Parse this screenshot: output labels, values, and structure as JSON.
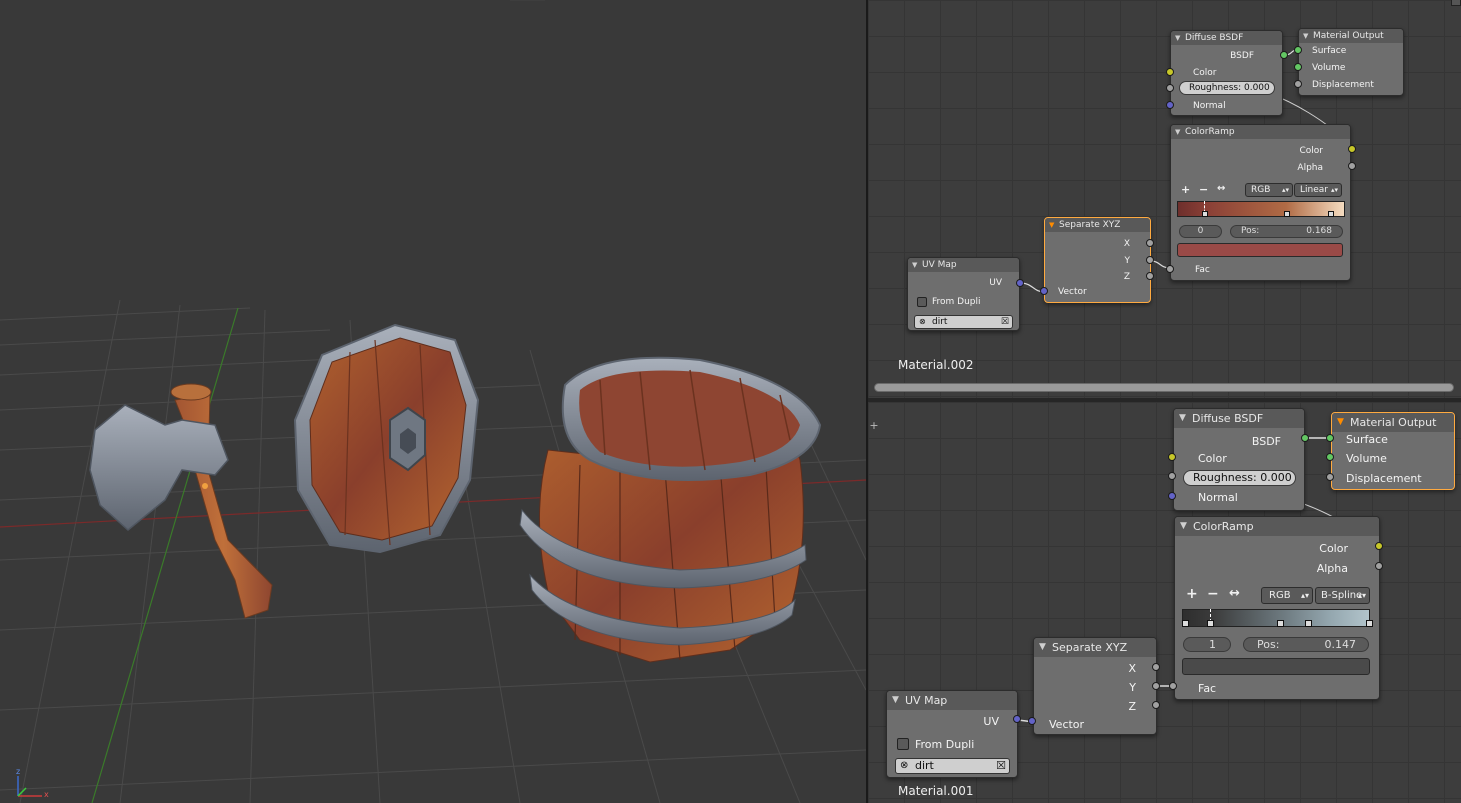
{
  "viewport": {
    "axis_labels": {
      "z": "z",
      "y": "y",
      "x": "x"
    }
  },
  "top_editor": {
    "material_name": "Material.002",
    "diffuse": {
      "title": "Diffuse BSDF",
      "out": "BSDF",
      "color": "Color",
      "roughness": "Roughness:  0.000",
      "normal": "Normal"
    },
    "output": {
      "title": "Material Output",
      "surface": "Surface",
      "volume": "Volume",
      "displacement": "Displacement"
    },
    "colorramp": {
      "title": "ColorRamp",
      "color": "Color",
      "alpha": "Alpha",
      "add": "+",
      "remove": "−",
      "flip": "↔",
      "mode": "RGB",
      "interp": "Linear",
      "index": "0",
      "pos_label": "Pos:",
      "pos": "0.168",
      "fac": "Fac"
    },
    "sepxyz": {
      "title": "Separate XYZ",
      "x": "X",
      "y": "Y",
      "z": "Z",
      "vector": "Vector"
    },
    "uvmap": {
      "title": "UV Map",
      "uv": "UV",
      "from_dupli": "From Dupli",
      "map": "dirt"
    }
  },
  "bottom_editor": {
    "material_name": "Material.001",
    "diffuse": {
      "title": "Diffuse BSDF",
      "out": "BSDF",
      "color": "Color",
      "roughness": "Roughness:  0.000",
      "normal": "Normal"
    },
    "output": {
      "title": "Material Output",
      "surface": "Surface",
      "volume": "Volume",
      "displacement": "Displacement"
    },
    "colorramp": {
      "title": "ColorRamp",
      "color": "Color",
      "alpha": "Alpha",
      "add": "+",
      "remove": "−",
      "flip": "↔",
      "mode": "RGB",
      "interp": "B-Spline",
      "index": "1",
      "pos_label": "Pos:",
      "pos": "0.147",
      "fac": "Fac"
    },
    "sepxyz": {
      "title": "Separate XYZ",
      "x": "X",
      "y": "Y",
      "z": "Z",
      "vector": "Vector"
    },
    "uvmap": {
      "title": "UV Map",
      "uv": "UV",
      "from_dupli": "From Dupli",
      "map": "dirt"
    }
  },
  "colors": {
    "active_border": "#ffaa40",
    "socket_color": "#c7c729",
    "socket_shader": "#63c763",
    "socket_float": "#a1a1a1",
    "socket_vector": "#6363c7",
    "top_swatch": "#9a4a47",
    "bottom_swatch": "#4a4a4a"
  }
}
